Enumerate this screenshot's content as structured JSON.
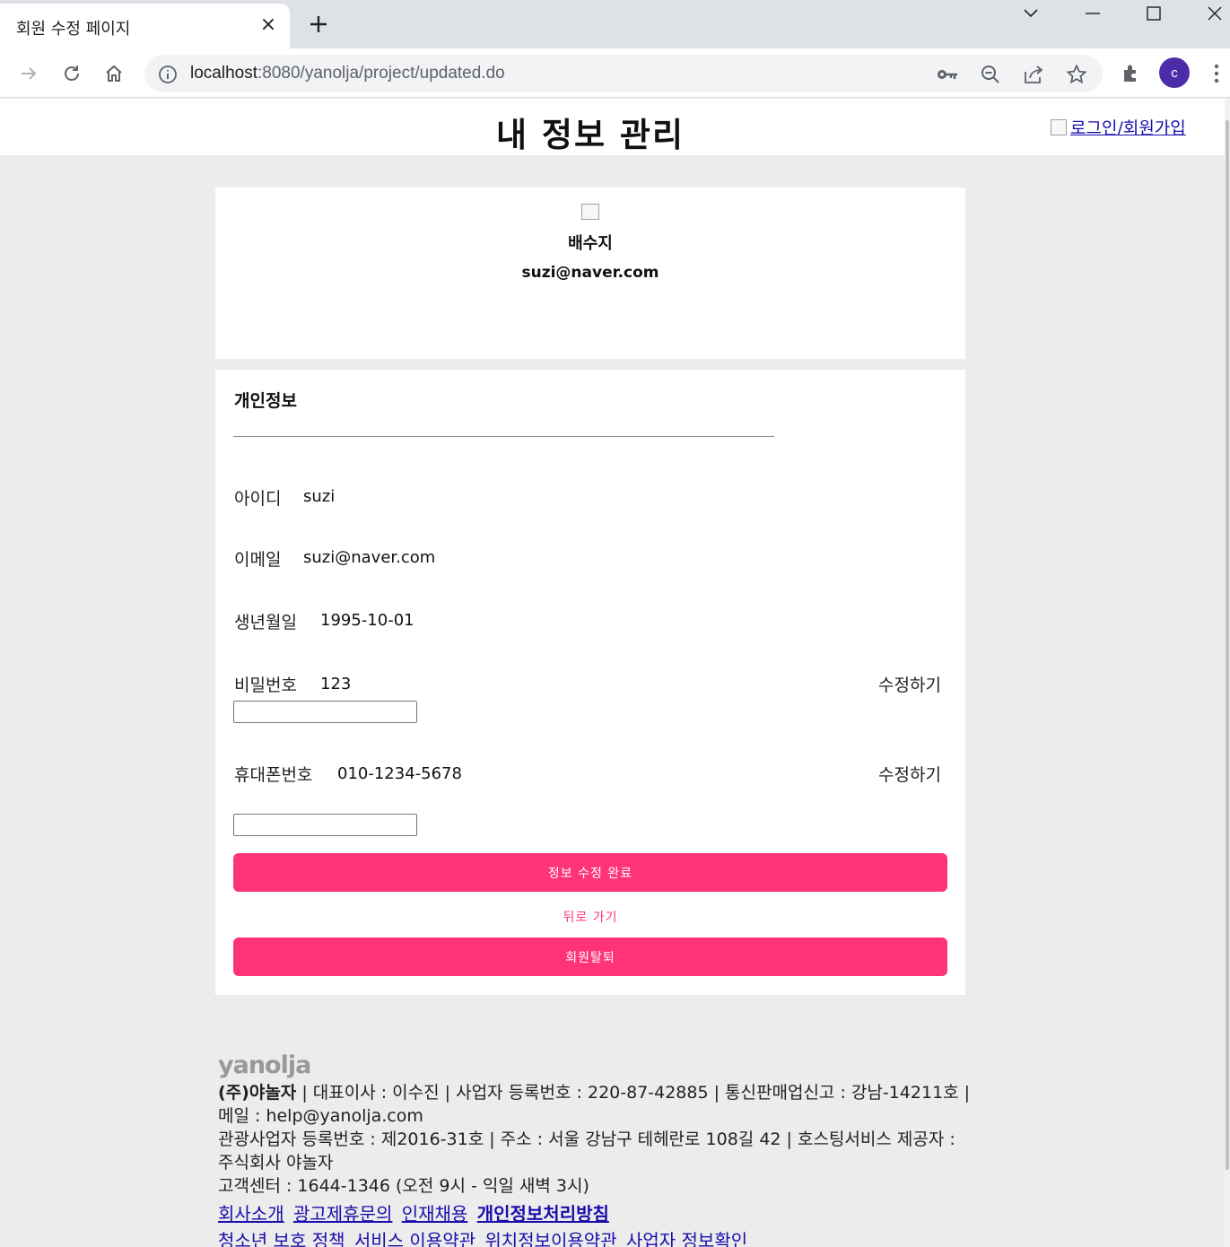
{
  "browser": {
    "tab_title": "회원 수정 페이지",
    "url_host": "localhost",
    "url_rest": ":8080/yanolja/project/updated.do",
    "profile_initial": "c"
  },
  "header": {
    "title": "내 정보 관리",
    "login_link": "로그인/회원가입"
  },
  "profile": {
    "name": "배수지",
    "email": "suzi@naver.com"
  },
  "info": {
    "section_title": "개인정보",
    "id_label": "아이디",
    "id_value": "suzi",
    "email_label": "이메일",
    "email_value": "suzi@naver.com",
    "birth_label": "생년월일",
    "birth_value": "1995-10-01",
    "password_label": "비밀번호",
    "password_value": "123",
    "phone_label": "휴대폰번호",
    "phone_value": "010-1234-5678",
    "edit_label": "수정하기",
    "password_input": "",
    "phone_input": "",
    "submit_label": "정보 수정 완료",
    "back_label": "뒤로 가기",
    "withdraw_label": "회원탈퇴"
  },
  "footer": {
    "logo": "yanolja",
    "company": "(주)야놀자",
    "line1_rest": " | 대표이사 : 이수진 | 사업자 등록번호 : 220-87-42885 | 통신판매업신고 : 강남-14211호 | 메일 : help@yanolja.com",
    "line2": "관광사업자 등록번호 : 제2016-31호 | 주소 : 서울 강남구 테헤란로 108길 42 | 호스팅서비스 제공자 : 주식회사 야놀자",
    "line3": "고객센터 : 1644-1346 (오전 9시 - 익일 새벽 3시)",
    "links_row1": [
      "회사소개",
      "광고제휴문의",
      "인재채용",
      "개인정보처리방침"
    ],
    "links_row2": [
      "청소년 보호 정책",
      "서비스 이용약관",
      "위치정보이용약관",
      "사업자 정보확인"
    ]
  }
}
